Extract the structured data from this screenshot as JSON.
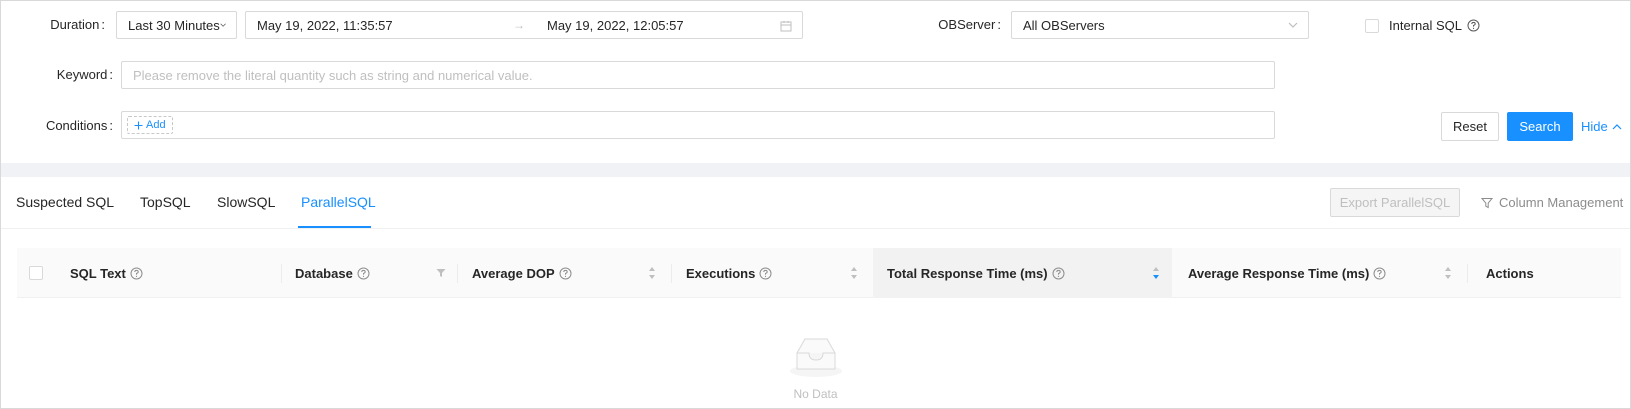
{
  "filters": {
    "duration": {
      "label": "Duration",
      "value": "Last 30 Minutes"
    },
    "range": {
      "start": "May 19, 2022, 11:35:57",
      "end": "May 19, 2022, 12:05:57"
    },
    "observer": {
      "label": "OBServer",
      "value": "All OBServers"
    },
    "internal_sql": {
      "label": "Internal SQL",
      "checked": false
    },
    "keyword": {
      "label": "Keyword",
      "placeholder": "Please remove the literal quantity such as string and numerical value."
    },
    "conditions": {
      "label": "Conditions",
      "add_label": "Add"
    },
    "colon": ":"
  },
  "actions": {
    "reset": "Reset",
    "search": "Search",
    "hide": "Hide"
  },
  "tabs": {
    "items": [
      {
        "label": "Suspected SQL",
        "active": false
      },
      {
        "label": "TopSQL",
        "active": false
      },
      {
        "label": "SlowSQL",
        "active": false
      },
      {
        "label": "ParallelSQL",
        "active": true
      }
    ],
    "export_label": "Export ParallelSQL",
    "column_management_label": "Column Management"
  },
  "table": {
    "columns": [
      {
        "label": "SQL Text"
      },
      {
        "label": "Database"
      },
      {
        "label": "Average DOP"
      },
      {
        "label": "Executions"
      },
      {
        "label": "Total Response Time (ms)",
        "sort": "descend"
      },
      {
        "label": "Average Response Time (ms)"
      },
      {
        "label": "Actions"
      }
    ],
    "rows": [],
    "empty_text": "No Data"
  },
  "colors": {
    "primary": "#1890ff",
    "border": "#d9d9d9",
    "muted": "#bfbfbf",
    "page_bg": "#f0f2f5"
  }
}
